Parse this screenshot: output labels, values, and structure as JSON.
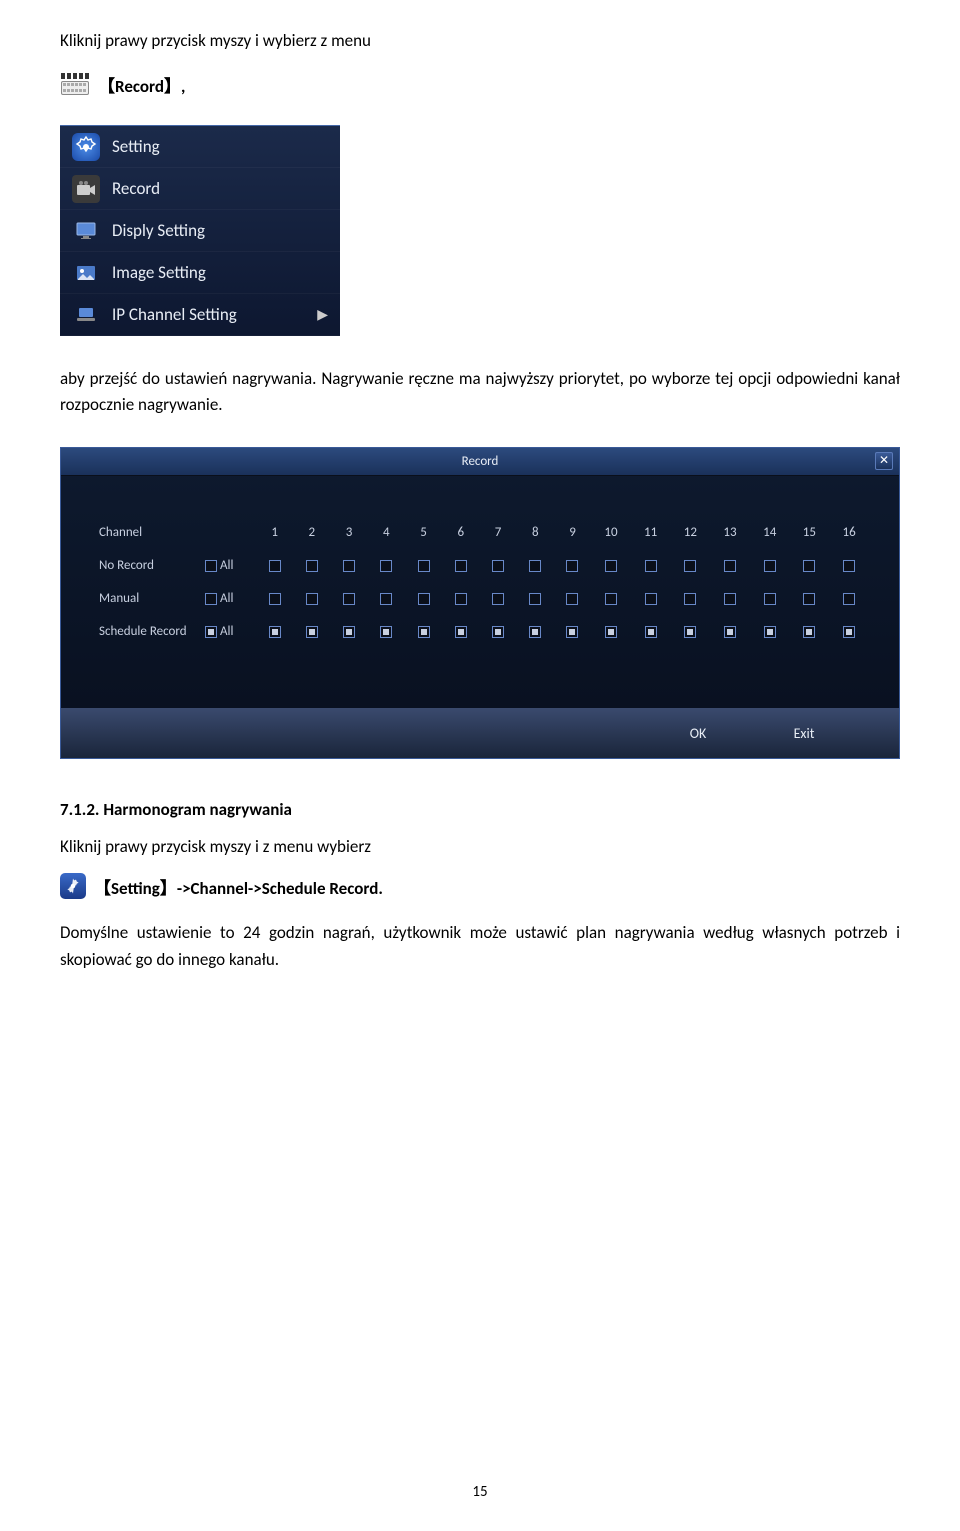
{
  "intro": {
    "p1": "Kliknij prawy przycisk myszy i wybierz z menu",
    "record_label": "【Record】,"
  },
  "context_menu": {
    "items": [
      {
        "label": "Setting",
        "icon": "gear-icon",
        "arrow": false
      },
      {
        "label": "Record",
        "icon": "camera-icon",
        "arrow": false
      },
      {
        "label": "Disply Setting",
        "icon": "monitor-icon",
        "arrow": false
      },
      {
        "label": "Image Setting",
        "icon": "image-icon",
        "arrow": false
      },
      {
        "label": "IP Channel Setting",
        "icon": "laptop-icon",
        "arrow": true
      }
    ]
  },
  "p_after_menu": "aby przejść do ustawień nagrywania. Nagrywanie ręczne ma najwyższy priorytet, po wyborze tej opcji odpowiedni kanał rozpocznie nagrywanie.",
  "record_dialog": {
    "title": "Record",
    "channels": [
      "Channel",
      "1",
      "2",
      "3",
      "4",
      "5",
      "6",
      "7",
      "8",
      "9",
      "10",
      "11",
      "12",
      "13",
      "14",
      "15",
      "16"
    ],
    "rows": [
      {
        "label": "No Record",
        "all": "All",
        "allChecked": false,
        "checks": [
          false,
          false,
          false,
          false,
          false,
          false,
          false,
          false,
          false,
          false,
          false,
          false,
          false,
          false,
          false,
          false
        ]
      },
      {
        "label": "Manual",
        "all": "All",
        "allChecked": false,
        "checks": [
          false,
          false,
          false,
          false,
          false,
          false,
          false,
          false,
          false,
          false,
          false,
          false,
          false,
          false,
          false,
          false
        ]
      },
      {
        "label": "Schedule Record",
        "all": "All",
        "allChecked": true,
        "checks": [
          true,
          true,
          true,
          true,
          true,
          true,
          true,
          true,
          true,
          true,
          true,
          true,
          true,
          true,
          true,
          true
        ]
      }
    ],
    "buttons": {
      "ok": "OK",
      "exit": "Exit"
    }
  },
  "section": {
    "heading": "7.1.2. Harmonogram nagrywania",
    "p3": "Kliknij prawy przycisk myszy i z menu wybierz",
    "setting_label": "【Setting】->Channel->Schedule Record.",
    "p4": "Domyślne ustawienie to 24 godzin nagrań, użytkownik może ustawić plan nagrywania według własnych potrzeb i skopiować go do innego kanału."
  },
  "page_number": "15"
}
